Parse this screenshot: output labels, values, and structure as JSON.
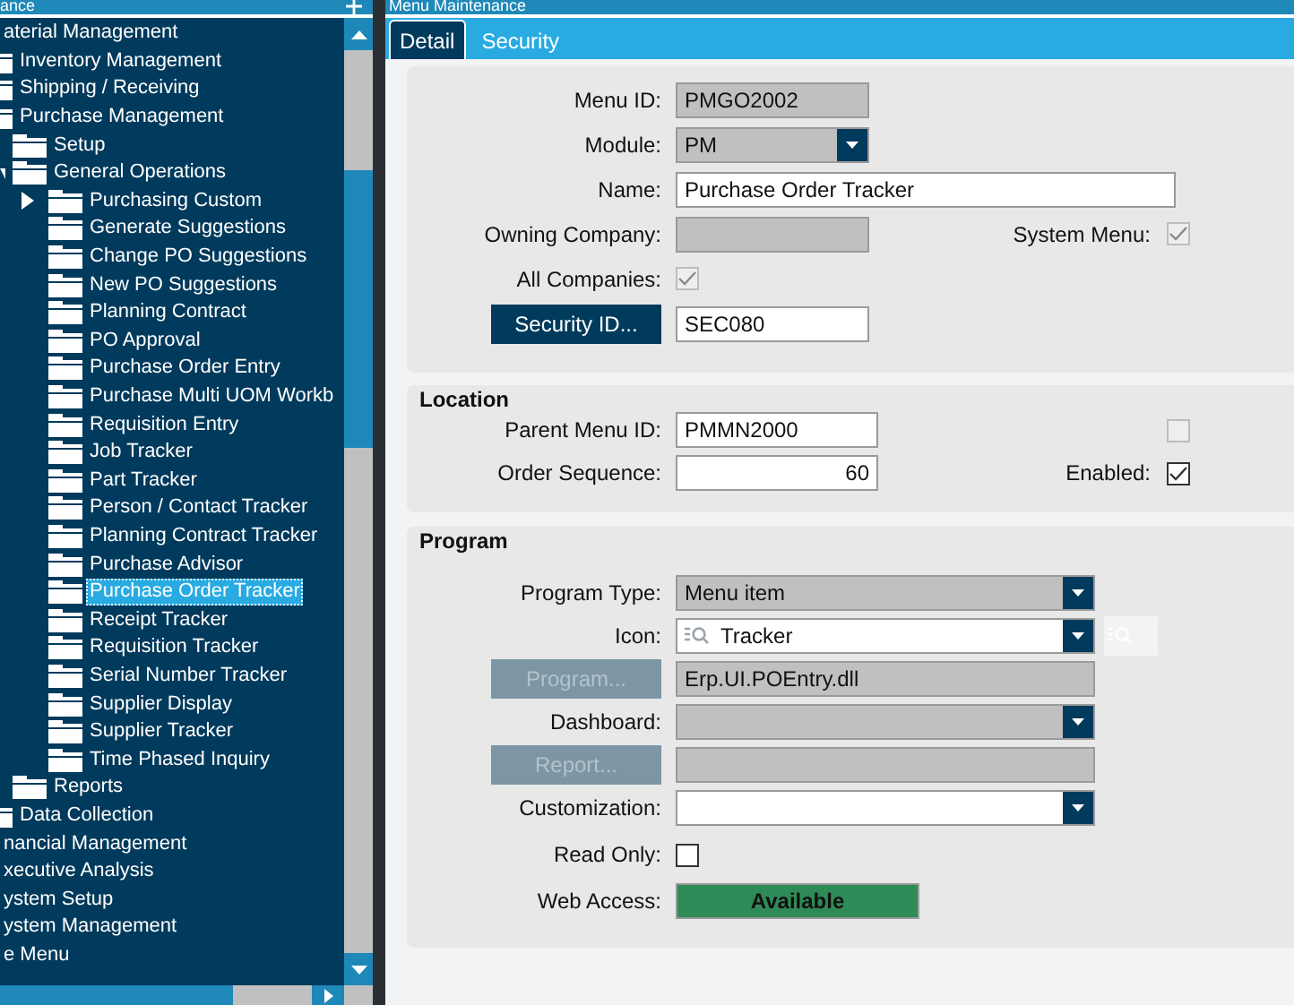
{
  "left_pane": {
    "title": "ance",
    "tree": [
      {
        "label": "aterial Management",
        "selected": false,
        "children": [
          {
            "label": "Inventory Management",
            "selected": false
          },
          {
            "label": "Shipping / Receiving",
            "selected": false
          },
          {
            "label": "Purchase Management",
            "selected": false,
            "children": [
              {
                "label": "Setup",
                "selected": false
              },
              {
                "label": "General Operations",
                "selected": false,
                "expanded": true,
                "children": [
                  {
                    "label": "Purchasing Custom",
                    "selected": false,
                    "expanded": false
                  },
                  {
                    "label": "Generate Suggestions",
                    "selected": false
                  },
                  {
                    "label": "Change PO Suggestions",
                    "selected": false
                  },
                  {
                    "label": "New PO Suggestions",
                    "selected": false
                  },
                  {
                    "label": "Planning Contract",
                    "selected": false
                  },
                  {
                    "label": "PO Approval",
                    "selected": false
                  },
                  {
                    "label": "Purchase Order Entry",
                    "selected": false
                  },
                  {
                    "label": "Purchase Multi UOM Workb",
                    "selected": false
                  },
                  {
                    "label": "Requisition Entry",
                    "selected": false
                  },
                  {
                    "label": "Job Tracker",
                    "selected": false
                  },
                  {
                    "label": "Part Tracker",
                    "selected": false
                  },
                  {
                    "label": "Person / Contact Tracker",
                    "selected": false
                  },
                  {
                    "label": "Planning Contract Tracker",
                    "selected": false
                  },
                  {
                    "label": "Purchase Advisor",
                    "selected": false
                  },
                  {
                    "label": "Purchase Order Tracker",
                    "selected": true
                  },
                  {
                    "label": "Receipt Tracker",
                    "selected": false
                  },
                  {
                    "label": "Requisition Tracker",
                    "selected": false
                  },
                  {
                    "label": "Serial Number Tracker",
                    "selected": false
                  },
                  {
                    "label": "Supplier Display",
                    "selected": false
                  },
                  {
                    "label": "Supplier Tracker",
                    "selected": false
                  },
                  {
                    "label": "Time Phased Inquiry",
                    "selected": false
                  }
                ]
              },
              {
                "label": "Reports",
                "selected": false
              }
            ]
          },
          {
            "label": "Data Collection",
            "selected": false
          }
        ]
      },
      {
        "label": "nancial Management",
        "selected": false
      },
      {
        "label": "xecutive Analysis",
        "selected": false
      },
      {
        "label": "ystem Setup",
        "selected": false
      },
      {
        "label": "ystem Management",
        "selected": false
      },
      {
        "label": "e Menu",
        "selected": false
      }
    ]
  },
  "window": {
    "title": "Menu Maintenance"
  },
  "tabs": [
    {
      "label": "Detail",
      "selected": true
    },
    {
      "label": "Security",
      "selected": false
    }
  ],
  "detail": {
    "menu_id": {
      "label": "Menu ID:",
      "value": "PMGO2002",
      "disabled": true
    },
    "module": {
      "label": "Module:",
      "value": "PM",
      "disabled": true
    },
    "name": {
      "label": "Name:",
      "value": "Purchase Order Tracker",
      "disabled": false
    },
    "owning_company": {
      "label": "Owning Company:",
      "disabled": true
    },
    "system_menu": {
      "label": "System Menu:",
      "checked": true,
      "disabled": true
    },
    "all_companies": {
      "label": "All Companies:",
      "checked": true,
      "disabled": true
    },
    "security_id": {
      "button": "Security ID...",
      "value": "SEC080",
      "disabled": false
    }
  },
  "location": {
    "title": "Location",
    "parent_menu_id": {
      "label": "Parent Menu ID:",
      "value": "PMMN2000",
      "disabled": false
    },
    "order_sequence": {
      "label": "Order Sequence:",
      "value": "60",
      "disabled": false
    },
    "unlabeled_checkbox": {
      "checked": false,
      "disabled": true
    },
    "enabled": {
      "label": "Enabled:",
      "checked": true,
      "disabled": false
    }
  },
  "program": {
    "title": "Program",
    "program_type": {
      "label": "Program Type:",
      "value": "Menu item",
      "disabled": true
    },
    "icon": {
      "label": "Icon:",
      "value": "Tracker",
      "disabled": false
    },
    "program_button": {
      "label": "Program...",
      "disabled": true
    },
    "program_path": {
      "value": "Erp.UI.POEntry.dll",
      "disabled": true
    },
    "dashboard": {
      "label": "Dashboard:",
      "disabled": true
    },
    "report_button": {
      "label": "Report...",
      "disabled": true
    },
    "report_path": {
      "disabled": true
    },
    "customization": {
      "label": "Customization:",
      "disabled": false
    },
    "read_only": {
      "label": "Read Only:",
      "checked": false,
      "disabled": false
    },
    "web_access": {
      "label": "Web Access:",
      "value": "Available"
    }
  }
}
